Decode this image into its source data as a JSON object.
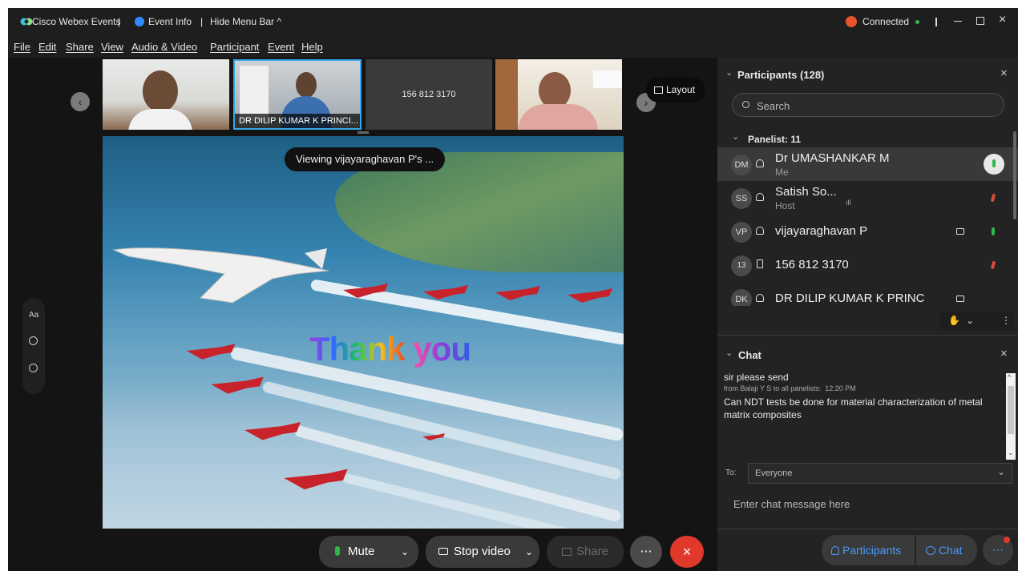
{
  "titlebar": {
    "app_name": "Cisco Webex Events",
    "sep1": "|",
    "event_info": "Event Info",
    "sep2": "|",
    "hide_menu": "Hide Menu Bar",
    "status": "Connected"
  },
  "menubar": [
    "File",
    "Edit",
    "Share",
    "View",
    "Audio & Video",
    "Participant",
    "Event",
    "Help"
  ],
  "video_strip": {
    "tile2_name": "DR DILIP KUMAR K PRINCI...",
    "tile3_number": "156 812 3170",
    "layout_label": "Layout"
  },
  "share": {
    "viewing_label": "Viewing vijayaraghavan P's ...",
    "thank": "Thank",
    "you": "you"
  },
  "participants": {
    "title": "Participants (128)",
    "search_placeholder": "Search",
    "panelist_header": "Panelist: 11",
    "list": [
      {
        "initials": "DM",
        "name": "Dr UMASHANKAR M",
        "role": "Me"
      },
      {
        "initials": "SS",
        "name": "Satish So...",
        "role": "Host"
      },
      {
        "initials": "VP",
        "name": "vijayaraghavan P",
        "role": ""
      },
      {
        "initials": "13",
        "name": "156 812 3170",
        "role": ""
      },
      {
        "initials": "DK",
        "name": "DR DILIP KUMAR K PRINC",
        "role": ""
      }
    ]
  },
  "chat": {
    "title": "Chat",
    "msg1": "sir please send",
    "from": "from Balaji Y S to all panelists:",
    "time": "12:20 PM",
    "msg2": "Can NDT tests be done for material characterization of metal matrix composites",
    "to_label": "To:",
    "to_value": "Everyone",
    "placeholder": "Enter chat message here"
  },
  "controls": {
    "mute": "Mute",
    "stop_video": "Stop video",
    "share": "Share",
    "participants": "Participants",
    "chat": "Chat"
  },
  "colors": {
    "accent": "#2f8bff",
    "end_call": "#e0392c",
    "mic_active": "#2fb84a",
    "muted": "#d94a3a"
  }
}
